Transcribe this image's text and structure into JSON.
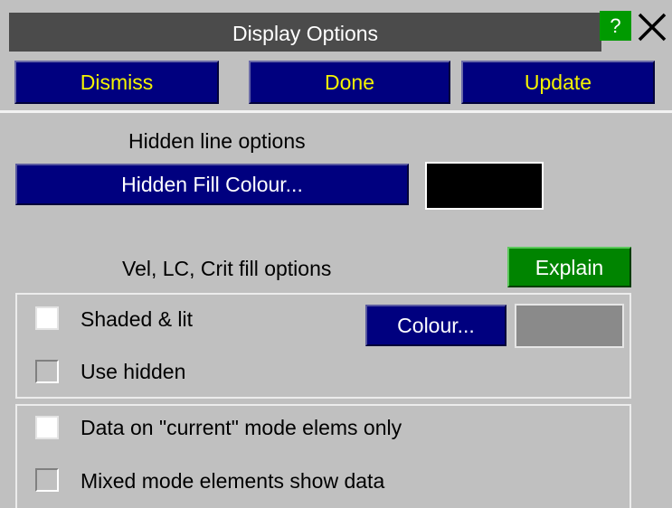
{
  "window": {
    "title": "Display Options",
    "help_label": "?"
  },
  "toolbar": {
    "dismiss_label": "Dismiss",
    "done_label": "Done",
    "update_label": "Update"
  },
  "hidden_line": {
    "heading": "Hidden line options",
    "fill_colour_label": "Hidden Fill Colour...",
    "fill_colour": "#000000"
  },
  "fill_options": {
    "heading": "Vel, LC, Crit fill options",
    "explain_label": "Explain",
    "shaded_lit": {
      "label": "Shaded & lit",
      "checked": false
    },
    "colour_label": "Colour...",
    "colour_swatch": "#8a8a8a",
    "use_hidden": {
      "label": "Use hidden",
      "checked": false
    }
  },
  "data_options": {
    "current_mode": {
      "label": "Data on \"current\" mode elems only",
      "checked": false
    },
    "mixed_mode": {
      "label": "Mixed mode elements show data",
      "checked": false
    }
  },
  "colors": {
    "button_blue": "#00007f",
    "button_text_yellow": "#f4f400",
    "explain_green": "#008400",
    "help_green": "#009a00",
    "panel_grey": "#c0c0c0"
  }
}
